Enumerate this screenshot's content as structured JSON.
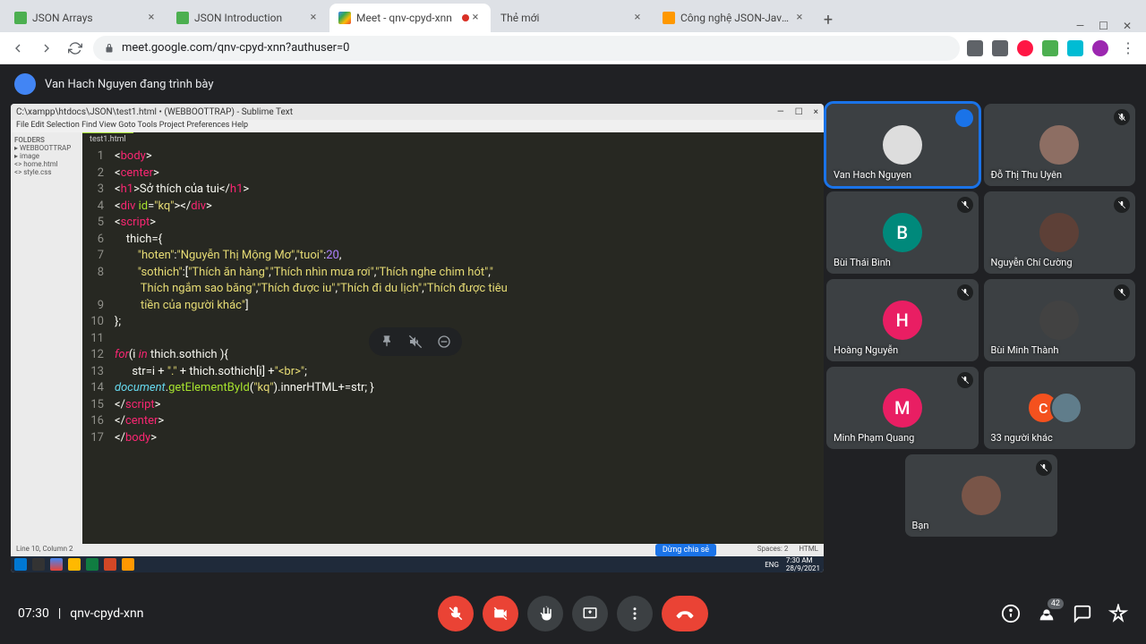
{
  "browser": {
    "tabs": [
      {
        "title": "JSON Arrays",
        "active": false
      },
      {
        "title": "JSON Introduction",
        "active": false
      },
      {
        "title": "Meet - qnv-cpyd-xnn",
        "active": true,
        "recording": true
      },
      {
        "title": "Thẻ mới",
        "active": false
      },
      {
        "title": "Công nghệ JSON-Javacript",
        "active": false
      }
    ],
    "url": "meet.google.com/qnv-cpyd-xnn?authuser=0"
  },
  "meet": {
    "presenting": "Van Hach Nguyen đang trình bày",
    "time": "07:30",
    "code": "qnv-cpyd-xnn",
    "participant_count": "42"
  },
  "participants": [
    {
      "name": "Van Hach Nguyen",
      "initial": "",
      "color": "#fff",
      "speaking": true,
      "muted": false,
      "photo": true
    },
    {
      "name": "Đỗ Thị Thu Uyên",
      "initial": "",
      "color": "#fff",
      "muted": true,
      "photo": true
    },
    {
      "name": "Bùi Thái Bình",
      "initial": "B",
      "color": "#00897b",
      "muted": true
    },
    {
      "name": "Nguyễn Chí Cường",
      "initial": "",
      "color": "#fff",
      "muted": true,
      "photo": true
    },
    {
      "name": "Hoàng Nguyễn",
      "initial": "H",
      "color": "#e91e63",
      "muted": true
    },
    {
      "name": "Bùi Minh Thành",
      "initial": "",
      "color": "#fff",
      "muted": true,
      "photo": true
    },
    {
      "name": "Minh Phạm Quang",
      "initial": "M",
      "color": "#e91e63",
      "muted": true
    },
    {
      "name": "33 người khác",
      "initial": "C",
      "color": "#f4511e",
      "muted": false,
      "extra": true
    }
  ],
  "self": {
    "name": "Bạn",
    "muted": true
  },
  "sublime": {
    "title": "C:\\xampp\\htdocs\\JSON\\test1.html • (WEBBOOTTRAP) - Sublime Text",
    "menu": "File  Edit  Selection  Find  View  Goto  Tools  Project  Preferences  Help",
    "folders_header": "FOLDERS",
    "folders": [
      "▸ WEBBOOTTRAP",
      "  ▸ image",
      "  <> home.html",
      "  <> style.css"
    ],
    "filetab": "test1.html",
    "status_left": "Line 10, Column 2",
    "status_right": [
      "Spaces: 2",
      "HTML"
    ],
    "stop_share": "Dừng chia sẻ",
    "code_lines": 17
  },
  "taskbar": {
    "time": "7:30 AM",
    "date": "28/9/2021",
    "lang": "ENG"
  }
}
